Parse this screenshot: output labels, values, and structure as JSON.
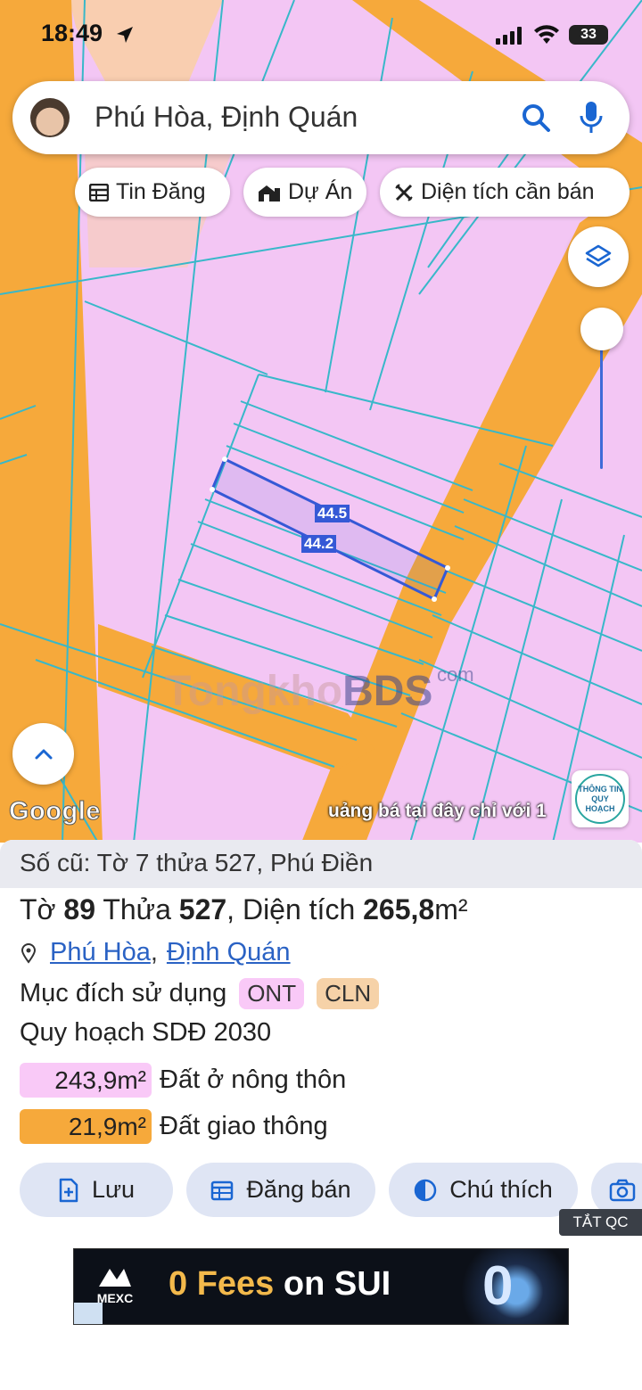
{
  "status": {
    "time": "18:49",
    "battery": "33"
  },
  "search": {
    "query": "Phú Hòa, Định Quán"
  },
  "chips": [
    {
      "label": "Tin Đăng",
      "icon": "table-icon"
    },
    {
      "label": "Dự Án",
      "icon": "building-icon"
    },
    {
      "label": "Diện tích cần bán",
      "icon": "ruler-cross-icon"
    }
  ],
  "map": {
    "measurements": [
      "44.5",
      "44.2"
    ],
    "watermark": {
      "part1": "Tongkho",
      "part2": "BDS",
      "suffix": "com"
    },
    "google_logo": "Google",
    "marquee": "uảng bá tại đây chỉ với 1",
    "qh_badge": {
      "line1": "THÔNG TIN",
      "line2": "QUY HOẠCH"
    },
    "colors": {
      "land": "#f3c6f4",
      "road": "#f6a93b",
      "parcel_line": "#38b8c9",
      "selection": "#3559d6"
    }
  },
  "panel": {
    "old_ref": "Số cũ: Tờ 7 thửa 527, Phú Điền",
    "parcel": {
      "to_label": "Tờ",
      "to_value": "89",
      "thua_label": "Thửa",
      "thua_value": "527",
      "area_label": ", Diện tích",
      "area_value": "265,8",
      "area_unit": "m²"
    },
    "location": {
      "ward": "Phú Hòa",
      "sep": ",",
      "district": "Định Quán"
    },
    "purpose_label": "Mục đích sử dụng",
    "purpose_tags": [
      "ONT",
      "CLN"
    ],
    "plan_title": "Quy hoạch SDĐ 2030",
    "plan_areas": [
      {
        "value": "243,9m²",
        "label": "Đất ở nông thôn",
        "color": "#f9c9f7"
      },
      {
        "value": "21,9m²",
        "label": "Đất giao thông",
        "color": "#f6a93b"
      }
    ],
    "actions": [
      {
        "label": "Lưu",
        "icon": "save-doc-icon"
      },
      {
        "label": "Đăng bán",
        "icon": "calendar-icon"
      },
      {
        "label": "Chú thích",
        "icon": "half-circle-icon"
      },
      {
        "label": "",
        "icon": "camera-icon"
      }
    ],
    "ad_close": "TẮT QC",
    "ad": {
      "brand": "MEXC",
      "text_highlight": "0 Fees",
      "text_rest": " on SUI",
      "coin_char": "0"
    }
  }
}
